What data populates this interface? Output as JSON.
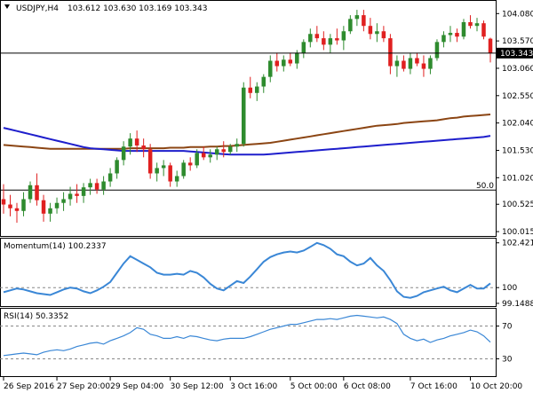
{
  "header": {
    "symbol": "USDJPY,H4",
    "ohlc": "103.612 103.630 103.169 103.343"
  },
  "colors": {
    "bull": "#2e8b2e",
    "bear": "#e02020",
    "ma_fast": "#8b4513",
    "ma_slow": "#1e1ecc",
    "indicator": "#3a87d6",
    "grid": "#000000",
    "level": "#888888"
  },
  "chart_data": [
    {
      "type": "candlestick",
      "name": "price",
      "title": "USDJPY,H4",
      "ylim": [
        99.95,
        104.3
      ],
      "y_ticks": [
        "104.080",
        "103.570",
        "103.060",
        "102.550",
        "102.040",
        "101.530",
        "101.020",
        "100.525",
        "100.015"
      ],
      "y_tick_values": [
        104.08,
        103.57,
        103.06,
        102.55,
        102.04,
        101.53,
        101.02,
        100.525,
        100.015
      ],
      "current_price": 103.343,
      "current_price_label": "103.343",
      "level_label": "50.0",
      "level_value": 100.79,
      "candles": [
        [
          100.62,
          100.9,
          100.35,
          100.52
        ],
        [
          100.52,
          100.7,
          100.3,
          100.45
        ],
        [
          100.45,
          100.55,
          100.18,
          100.4
        ],
        [
          100.4,
          100.75,
          100.3,
          100.62
        ],
        [
          100.62,
          100.95,
          100.55,
          100.88
        ],
        [
          100.88,
          101.1,
          100.5,
          100.6
        ],
        [
          100.6,
          100.7,
          100.2,
          100.35
        ],
        [
          100.35,
          100.55,
          100.2,
          100.45
        ],
        [
          100.45,
          100.65,
          100.35,
          100.55
        ],
        [
          100.55,
          100.75,
          100.4,
          100.62
        ],
        [
          100.62,
          100.85,
          100.5,
          100.72
        ],
        [
          100.72,
          100.9,
          100.55,
          100.68
        ],
        [
          100.68,
          100.92,
          100.55,
          100.84
        ],
        [
          100.84,
          101.0,
          100.7,
          100.92
        ],
        [
          100.92,
          101.0,
          100.72,
          100.8
        ],
        [
          100.8,
          101.05,
          100.7,
          100.95
        ],
        [
          100.95,
          101.2,
          100.85,
          101.1
        ],
        [
          101.1,
          101.4,
          101.0,
          101.35
        ],
        [
          101.35,
          101.7,
          101.25,
          101.6
        ],
        [
          101.6,
          101.85,
          101.45,
          101.75
        ],
        [
          101.75,
          101.9,
          101.5,
          101.62
        ],
        [
          101.62,
          101.75,
          101.4,
          101.55
        ],
        [
          101.55,
          101.65,
          101.0,
          101.1
        ],
        [
          101.1,
          101.3,
          100.95,
          101.2
        ],
        [
          101.2,
          101.35,
          101.05,
          101.25
        ],
        [
          101.25,
          101.3,
          100.85,
          100.95
        ],
        [
          100.95,
          101.15,
          100.85,
          101.05
        ],
        [
          101.05,
          101.35,
          101.0,
          101.3
        ],
        [
          101.3,
          101.4,
          101.15,
          101.25
        ],
        [
          101.25,
          101.55,
          101.2,
          101.48
        ],
        [
          101.48,
          101.6,
          101.35,
          101.4
        ],
        [
          101.4,
          101.55,
          101.3,
          101.45
        ],
        [
          101.45,
          101.6,
          101.35,
          101.55
        ],
        [
          101.55,
          101.7,
          101.4,
          101.5
        ],
        [
          101.5,
          101.65,
          101.45,
          101.6
        ],
        [
          101.6,
          101.75,
          101.5,
          101.65
        ],
        [
          101.65,
          102.8,
          101.6,
          102.7
        ],
        [
          102.7,
          102.9,
          102.5,
          102.6
        ],
        [
          102.6,
          102.8,
          102.45,
          102.72
        ],
        [
          102.72,
          102.95,
          102.6,
          102.9
        ],
        [
          102.9,
          103.3,
          102.8,
          103.2
        ],
        [
          103.2,
          103.35,
          103.0,
          103.1
        ],
        [
          103.1,
          103.3,
          103.0,
          103.22
        ],
        [
          103.22,
          103.35,
          103.1,
          103.15
        ],
        [
          103.15,
          103.4,
          103.05,
          103.35
        ],
        [
          103.35,
          103.6,
          103.25,
          103.55
        ],
        [
          103.55,
          103.8,
          103.45,
          103.7
        ],
        [
          103.7,
          103.85,
          103.55,
          103.62
        ],
        [
          103.62,
          103.75,
          103.4,
          103.5
        ],
        [
          103.5,
          103.7,
          103.35,
          103.62
        ],
        [
          103.62,
          103.8,
          103.5,
          103.58
        ],
        [
          103.58,
          103.85,
          103.4,
          103.75
        ],
        [
          103.75,
          104.05,
          103.7,
          103.98
        ],
        [
          103.98,
          104.15,
          103.85,
          104.05
        ],
        [
          104.05,
          104.15,
          103.75,
          103.85
        ],
        [
          103.85,
          104.0,
          103.6,
          103.7
        ],
        [
          103.7,
          103.9,
          103.55,
          103.75
        ],
        [
          103.75,
          103.85,
          103.55,
          103.62
        ],
        [
          103.62,
          103.7,
          102.95,
          103.1
        ],
        [
          103.1,
          103.3,
          102.9,
          103.2
        ],
        [
          103.2,
          103.3,
          103.0,
          103.05
        ],
        [
          103.05,
          103.35,
          102.95,
          103.25
        ],
        [
          103.25,
          103.35,
          103.1,
          103.15
        ],
        [
          103.15,
          103.3,
          102.9,
          103.05
        ],
        [
          103.05,
          103.3,
          102.95,
          103.25
        ],
        [
          103.25,
          103.6,
          103.2,
          103.55
        ],
        [
          103.55,
          103.75,
          103.45,
          103.68
        ],
        [
          103.68,
          103.85,
          103.55,
          103.72
        ],
        [
          103.72,
          103.8,
          103.55,
          103.65
        ],
        [
          103.65,
          103.98,
          103.6,
          103.92
        ],
        [
          103.92,
          104.05,
          103.8,
          103.85
        ],
        [
          103.85,
          104.0,
          103.75,
          103.9
        ],
        [
          103.9,
          103.95,
          103.6,
          103.65
        ],
        [
          103.612,
          103.63,
          103.169,
          103.343
        ]
      ],
      "ma_fast": [
        101.63,
        101.62,
        101.61,
        101.6,
        101.59,
        101.58,
        101.57,
        101.56,
        101.56,
        101.56,
        101.56,
        101.56,
        101.56,
        101.56,
        101.56,
        101.56,
        101.56,
        101.56,
        101.56,
        101.57,
        101.57,
        101.57,
        101.57,
        101.57,
        101.57,
        101.58,
        101.58,
        101.58,
        101.59,
        101.59,
        101.59,
        101.6,
        101.6,
        101.61,
        101.61,
        101.62,
        101.63,
        101.64,
        101.65,
        101.66,
        101.67,
        101.69,
        101.71,
        101.73,
        101.75,
        101.77,
        101.79,
        101.81,
        101.83,
        101.85,
        101.87,
        101.89,
        101.91,
        101.93,
        101.95,
        101.97,
        101.99,
        102.0,
        102.01,
        102.02,
        102.04,
        102.05,
        102.06,
        102.07,
        102.08,
        102.09,
        102.11,
        102.13,
        102.14,
        102.16,
        102.17,
        102.18,
        102.19,
        102.2
      ],
      "ma_slow": [
        101.95,
        101.92,
        101.89,
        101.86,
        101.83,
        101.8,
        101.77,
        101.74,
        101.71,
        101.68,
        101.65,
        101.62,
        101.59,
        101.57,
        101.56,
        101.55,
        101.54,
        101.53,
        101.52,
        101.52,
        101.52,
        101.52,
        101.52,
        101.52,
        101.52,
        101.52,
        101.52,
        101.52,
        101.51,
        101.5,
        101.49,
        101.48,
        101.47,
        101.46,
        101.45,
        101.45,
        101.45,
        101.45,
        101.45,
        101.45,
        101.46,
        101.47,
        101.48,
        101.49,
        101.5,
        101.51,
        101.52,
        101.53,
        101.54,
        101.55,
        101.56,
        101.57,
        101.58,
        101.59,
        101.6,
        101.61,
        101.62,
        101.63,
        101.64,
        101.65,
        101.66,
        101.67,
        101.68,
        101.69,
        101.7,
        101.71,
        101.72,
        101.73,
        101.74,
        101.75,
        101.76,
        101.77,
        101.78,
        101.8
      ]
    },
    {
      "type": "line",
      "name": "momentum",
      "title": "Momentum(14) 100.2337",
      "ylim": [
        99.05,
        102.6
      ],
      "y_ticks": [
        "102.4214",
        "100",
        "99.1488"
      ],
      "y_tick_values": [
        102.4214,
        100,
        99.1488
      ],
      "level_value": 100,
      "values": [
        99.75,
        99.85,
        99.95,
        99.9,
        99.8,
        99.7,
        99.65,
        99.6,
        99.75,
        99.9,
        100.0,
        99.95,
        99.8,
        99.7,
        99.85,
        100.05,
        100.3,
        100.8,
        101.3,
        101.7,
        101.5,
        101.3,
        101.1,
        100.8,
        100.7,
        100.7,
        100.75,
        100.7,
        100.9,
        100.8,
        100.55,
        100.2,
        99.95,
        99.85,
        100.1,
        100.35,
        100.25,
        100.6,
        101.0,
        101.4,
        101.65,
        101.8,
        101.9,
        101.95,
        101.9,
        102.0,
        102.2,
        102.42,
        102.3,
        102.1,
        101.8,
        101.7,
        101.4,
        101.2,
        101.3,
        101.6,
        101.2,
        100.9,
        100.4,
        99.8,
        99.5,
        99.45,
        99.55,
        99.75,
        99.85,
        99.95,
        100.05,
        99.85,
        99.75,
        99.95,
        100.15,
        99.95,
        99.95,
        100.23
      ]
    },
    {
      "type": "line",
      "name": "rsi",
      "title": "RSI(14) 50.3352",
      "ylim": [
        10,
        90
      ],
      "y_ticks": [
        "70",
        "30"
      ],
      "y_tick_values": [
        70,
        30
      ],
      "levels": [
        70,
        30
      ],
      "values": [
        34,
        35,
        36,
        37,
        36,
        35,
        38,
        40,
        41,
        40,
        42,
        45,
        47,
        49,
        50,
        48,
        52,
        55,
        58,
        62,
        68,
        66,
        60,
        58,
        55,
        55,
        57,
        55,
        58,
        57,
        55,
        53,
        52,
        54,
        55,
        55,
        55,
        57,
        60,
        63,
        66,
        68,
        70,
        72,
        72,
        74,
        76,
        78,
        78,
        79,
        78,
        80,
        82,
        83,
        82,
        81,
        80,
        81,
        78,
        73,
        60,
        55,
        52,
        54,
        50,
        53,
        55,
        58,
        60,
        62,
        65,
        63,
        58,
        50.3
      ]
    }
  ],
  "x_axis": {
    "labels": [
      "26 Sep 2016",
      "27 Sep 20:00",
      "29 Sep 04:00",
      "30 Sep 12:00",
      "3 Oct 16:00",
      "5 Oct 00:00",
      "6 Oct 08:00",
      "7 Oct 16:00",
      "10 Oct 20:00"
    ],
    "label_bar_index": [
      0,
      8,
      16,
      25,
      34,
      43,
      51,
      61,
      70
    ]
  }
}
